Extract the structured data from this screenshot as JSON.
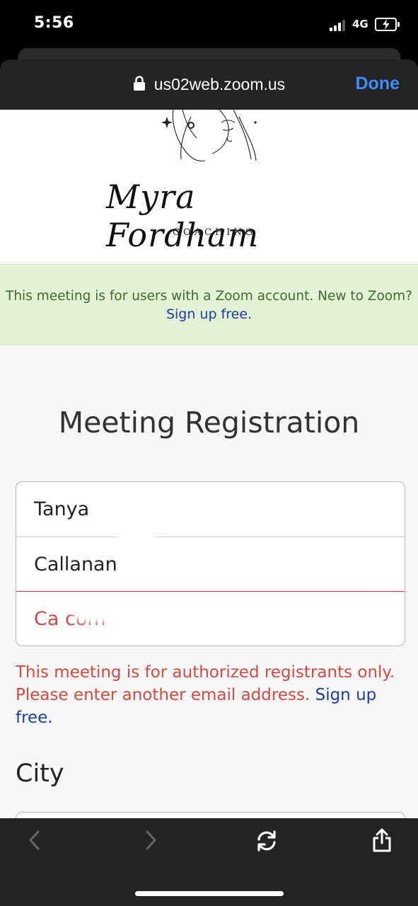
{
  "status_bar": {
    "time": "5:56",
    "network": "4G"
  },
  "browser": {
    "url": "us02web.zoom.us",
    "done_label": "Done",
    "accent_color": "#3e8ef7"
  },
  "header": {
    "brand_name": "Myra Fordham",
    "brand_sub": "COACHING"
  },
  "notice": {
    "text": "This meeting is for users with a Zoom account. New to Zoom?",
    "link": "Sign up free."
  },
  "form": {
    "title": "Meeting Registration",
    "first_name": "Tanya",
    "last_name": "Callanan",
    "email_value": "Ca                 com",
    "error_text": "This meeting is for authorized registrants only. Please enter another email address.",
    "error_link": "Sign up free.",
    "city_label": "City",
    "error_color": "#d34a43"
  },
  "toolbar": {
    "icons": [
      "back-icon",
      "forward-icon",
      "reload-icon",
      "share-icon"
    ]
  }
}
